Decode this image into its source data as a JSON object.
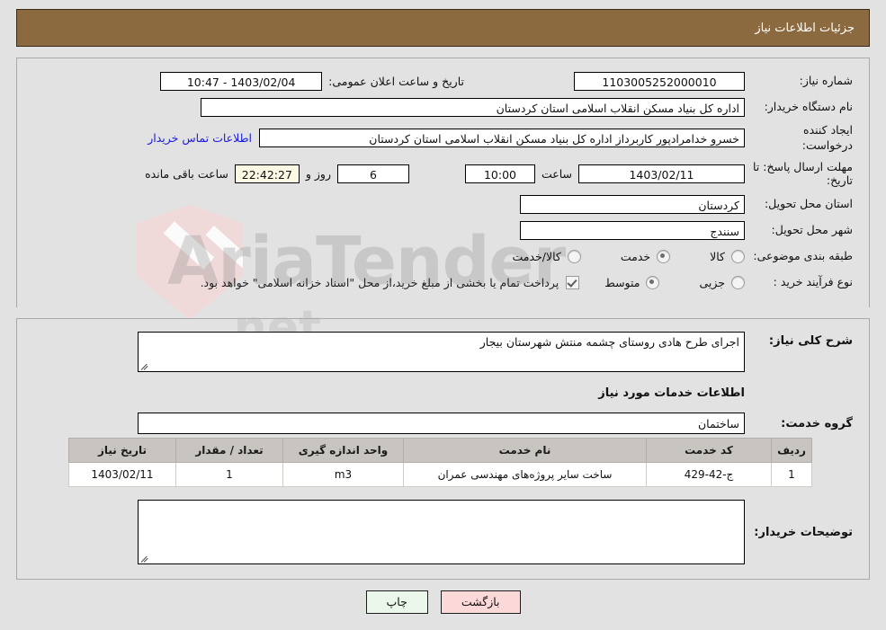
{
  "header": {
    "title": "جزئیات اطلاعات نیاز"
  },
  "form": {
    "need_number_label": "شماره نیاز:",
    "need_number_value": "1103005252000010",
    "announce_label": "تاریخ و ساعت اعلان عمومی:",
    "announce_value": "1403/02/04 - 10:47",
    "buyer_org_label": "نام دستگاه خریدار:",
    "buyer_org_value": "اداره کل بنیاد مسکن انقلاب اسلامی استان کردستان",
    "requester_label": "ایجاد کننده درخواست:",
    "requester_value": "خسرو خدامرادپور کاربرداز اداره کل بنیاد مسکن انقلاب اسلامی استان کردستان",
    "contact_link": "اطلاعات تماس خریدار",
    "deadline_label": "مهلت ارسال پاسخ: تا تاریخ:",
    "deadline_date": "1403/02/11",
    "hour_label": "ساعت",
    "deadline_time": "10:00",
    "days_value": "6",
    "days_label": "روز و",
    "remaining_time": "22:42:27",
    "remaining_label": "ساعت باقی مانده",
    "province_label": "استان محل تحویل:",
    "province_value": "کردستان",
    "city_label": "شهر محل تحویل:",
    "city_value": "سنندج",
    "category_label": "طبقه بندی موضوعی:",
    "category_options": [
      {
        "label": "کالا",
        "checked": false
      },
      {
        "label": "خدمت",
        "checked": true
      },
      {
        "label": "کالا/خدمت",
        "checked": false
      }
    ],
    "process_label": "نوع فرآیند خرید :",
    "process_options": [
      {
        "label": "جزیی",
        "checked": false
      },
      {
        "label": "متوسط",
        "checked": true
      }
    ],
    "treasury_checked": true,
    "treasury_note": "پرداخت تمام یا بخشی از مبلغ خرید،از محل \"اسناد خزانه اسلامی\" خواهد بود."
  },
  "middle": {
    "summary_label": "شرح کلی نیاز:",
    "summary_value": "اجرای طرح هادی روستای چشمه منتش شهرستان بیجار",
    "services_section_title": "اطلاعات خدمات مورد نیاز",
    "service_group_label": "گروه خدمت:",
    "service_group_value": "ساختمان"
  },
  "table": {
    "columns": [
      "ردیف",
      "کد خدمت",
      "نام خدمت",
      "واحد اندازه گیری",
      "تعداد / مقدار",
      "تاریخ نیاز"
    ],
    "rows": [
      {
        "index": "1",
        "code": "ج-42-429",
        "name": "ساخت سایر پروژه‌های مهندسی عمران",
        "unit": "m3",
        "quantity": "1",
        "date": "1403/02/11"
      }
    ]
  },
  "buyer_notes": {
    "label": "توضیحات خریدار:",
    "value": ""
  },
  "footer": {
    "print_label": "چاپ",
    "back_label": "بازگشت"
  },
  "watermark": {
    "line1": "AriaTender",
    "line2": ".net"
  },
  "colors": {
    "header_bar": "#8c6a3f",
    "link": "#1a1ae0",
    "table_header": "#c8c5c1",
    "print_button": "#eaf7ea",
    "back_button": "#fbd9d9"
  }
}
